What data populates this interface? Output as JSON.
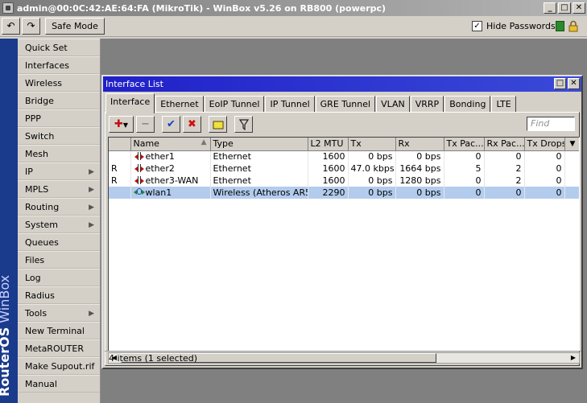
{
  "window": {
    "title": "admin@00:0C:42:AE:64:FA (MikroTik) - WinBox v5.26 on RB800 (powerpc)"
  },
  "toolbar": {
    "undo_icon": "undo-icon",
    "redo_icon": "redo-icon",
    "safe_mode_label": "Safe Mode",
    "hide_passwords_label": "Hide Passwords",
    "hide_passwords_checked": "✓"
  },
  "brand": {
    "part1": "RouterOS",
    "part2": "WinBox"
  },
  "menu": {
    "items": [
      {
        "label": "Quick Set",
        "has_submenu": false
      },
      {
        "label": "Interfaces",
        "has_submenu": false
      },
      {
        "label": "Wireless",
        "has_submenu": false
      },
      {
        "label": "Bridge",
        "has_submenu": false
      },
      {
        "label": "PPP",
        "has_submenu": false
      },
      {
        "label": "Switch",
        "has_submenu": false
      },
      {
        "label": "Mesh",
        "has_submenu": false
      },
      {
        "label": "IP",
        "has_submenu": true
      },
      {
        "label": "MPLS",
        "has_submenu": true
      },
      {
        "label": "Routing",
        "has_submenu": true
      },
      {
        "label": "System",
        "has_submenu": true
      },
      {
        "label": "Queues",
        "has_submenu": false
      },
      {
        "label": "Files",
        "has_submenu": false
      },
      {
        "label": "Log",
        "has_submenu": false
      },
      {
        "label": "Radius",
        "has_submenu": false
      },
      {
        "label": "Tools",
        "has_submenu": true
      },
      {
        "label": "New Terminal",
        "has_submenu": false
      },
      {
        "label": "MetaROUTER",
        "has_submenu": false
      },
      {
        "label": "Make Supout.rif",
        "has_submenu": false
      },
      {
        "label": "Manual",
        "has_submenu": false
      }
    ],
    "submenu_arrow": "▶"
  },
  "interface_list": {
    "title": "Interface List",
    "tabs": [
      "Interface",
      "Ethernet",
      "EoIP Tunnel",
      "IP Tunnel",
      "GRE Tunnel",
      "VLAN",
      "VRRP",
      "Bonding",
      "LTE"
    ],
    "active_tab": "Interface",
    "find_placeholder": "Find",
    "columns": [
      "",
      "Name",
      "Type",
      "L2 MTU",
      "Tx",
      "Rx",
      "Tx Pac...",
      "Rx Pac...",
      "Tx Drops"
    ],
    "sort_indicator": "▲",
    "column_menu": "▼",
    "rows": [
      {
        "flag": "",
        "icon": "ethernet-icon",
        "name": "ether1",
        "type": "Ethernet",
        "l2mtu": "1600",
        "tx": "0 bps",
        "rx": "0 bps",
        "txp": "0",
        "rxp": "0",
        "txd": "0",
        "selected": false
      },
      {
        "flag": "R",
        "icon": "ethernet-icon",
        "name": "ether2",
        "type": "Ethernet",
        "l2mtu": "1600",
        "tx": "47.0 kbps",
        "rx": "1664 bps",
        "txp": "5",
        "rxp": "2",
        "txd": "0",
        "selected": false
      },
      {
        "flag": "R",
        "icon": "ethernet-icon",
        "name": "ether3-WAN",
        "type": "Ethernet",
        "l2mtu": "1600",
        "tx": "0 bps",
        "rx": "1280 bps",
        "txp": "0",
        "rxp": "2",
        "txd": "0",
        "selected": false
      },
      {
        "flag": "",
        "icon": "wireless-icon",
        "name": "wlan1",
        "type": "Wireless (Atheros AR5...",
        "l2mtu": "2290",
        "tx": "0 bps",
        "rx": "0 bps",
        "txp": "0",
        "rxp": "0",
        "txd": "0",
        "selected": true
      }
    ],
    "status": "4 items (1 selected)"
  },
  "colors": {
    "window_title_bar": "#2a2ad0",
    "side_strip": "#1a3a8c",
    "selected_row": "#b3ccee",
    "workspace": "#808080"
  }
}
